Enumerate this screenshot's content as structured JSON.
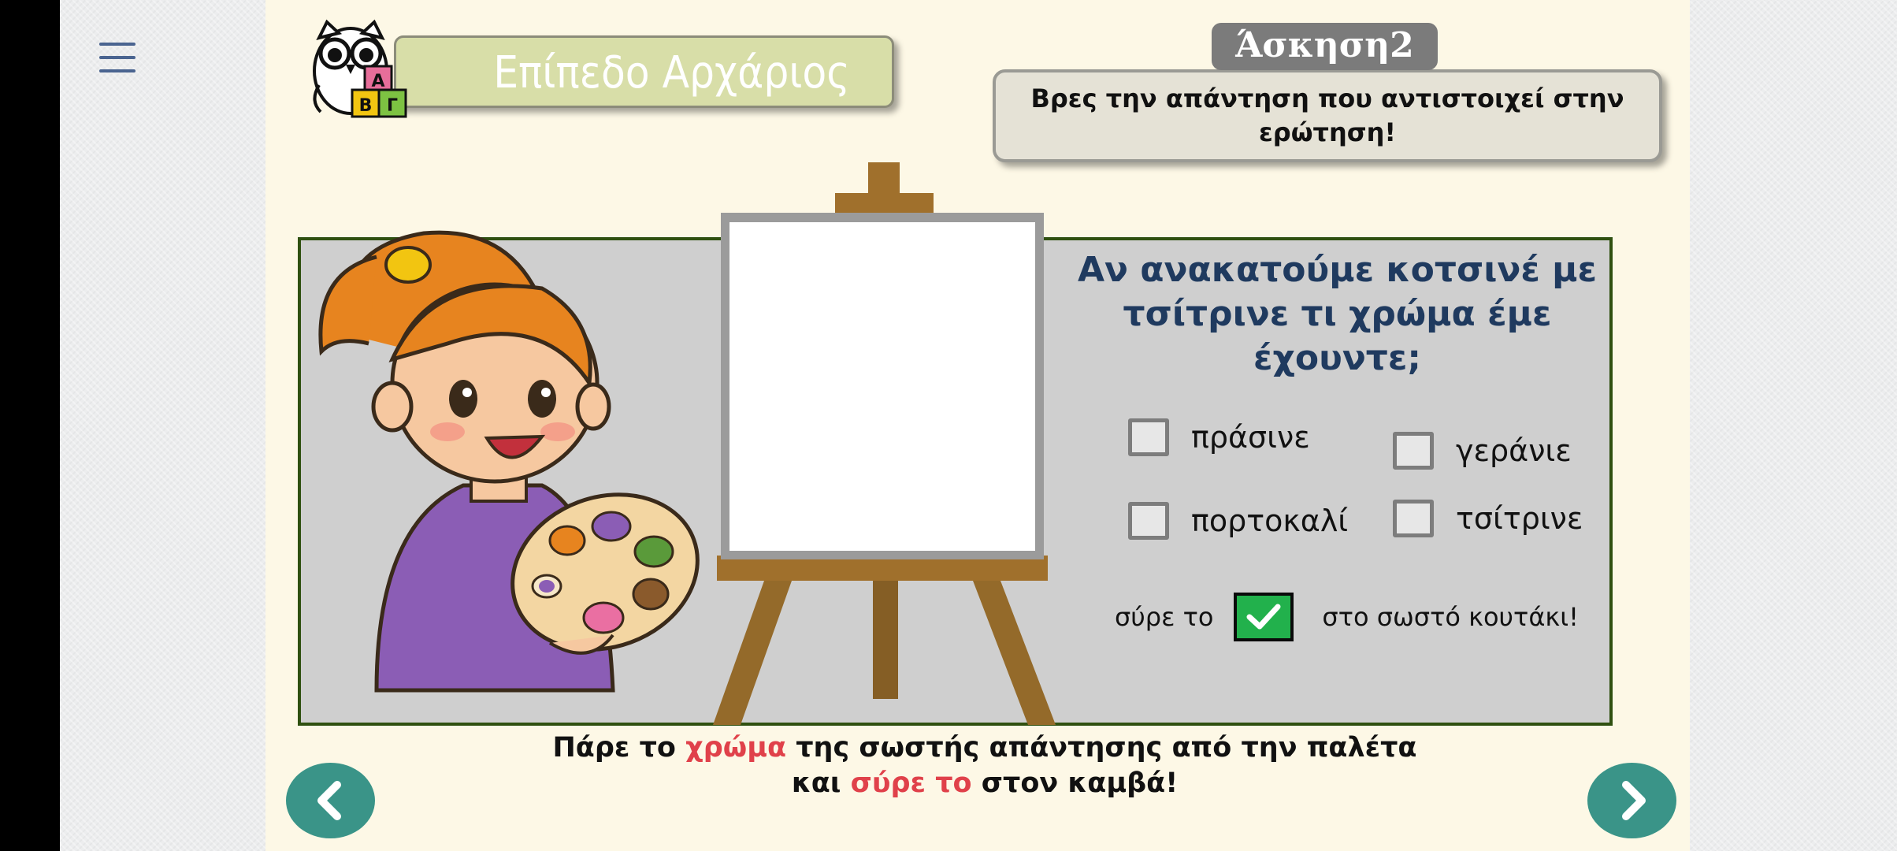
{
  "level": {
    "label": "Επίπεδο Αρχάριος"
  },
  "exercise": {
    "tag": "Άσκηση2",
    "instruction": "Βρες την απάντηση που αντιστοιχεί στην ερώτηση!"
  },
  "owl_blocks": [
    "Α",
    "Β",
    "Γ"
  ],
  "question": "Αν ανακατούμε κοτσινέ με τσίτρινε τι χρώμα έμε έχουντε;",
  "options": [
    {
      "label": "πράσινε"
    },
    {
      "label": "γεράνιε"
    },
    {
      "label": "πορτοκαλί"
    },
    {
      "label": "τσίτρινε"
    }
  ],
  "drag_hint": {
    "before": "σύρε το",
    "after": "στο σωστό κουτάκι!"
  },
  "bottom_instruction": {
    "part1": "Πάρε το",
    "highlight1": "χρώμα",
    "part2": "της σωστής απάντησης από την παλέτα",
    "part3": "και",
    "highlight2": "σύρε το",
    "part4": "στον καμβά!"
  },
  "colors": {
    "accent_green": "#22b14c",
    "nav_teal": "#3a9488",
    "panel_border": "#2f5010",
    "question_text": "#1f3a5f",
    "highlight": "#e0414a"
  },
  "icons": {
    "menu": "hamburger-icon",
    "prev": "chevron-left-icon",
    "next": "chevron-right-icon",
    "drag": "checkmark-icon"
  }
}
